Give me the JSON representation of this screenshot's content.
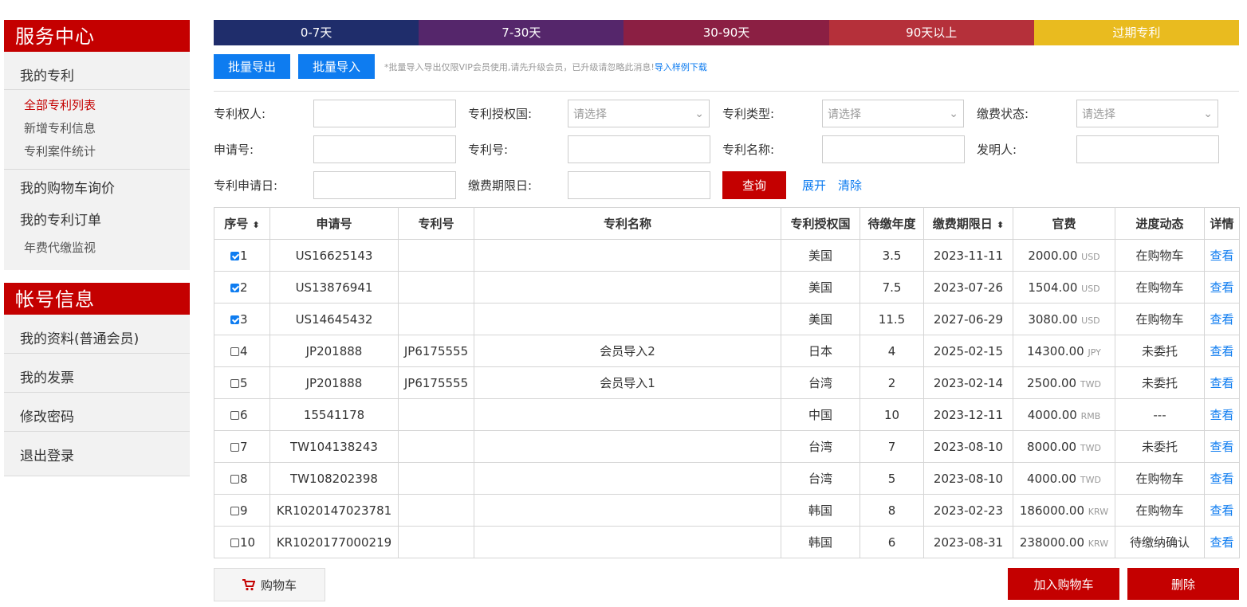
{
  "sidebar": {
    "service_title": "服务中心",
    "my_patents": "我的专利",
    "sub_items": [
      "全部专利列表",
      "新增专利信息",
      "专利案件统计"
    ],
    "cart_inquiry": "我的购物车询价",
    "my_orders": "我的专利订单",
    "annual_monitor": "年费代缴监视",
    "account_title": "帐号信息",
    "account_items": [
      "我的资料(普通会员)",
      "我的发票",
      "修改密码",
      "退出登录"
    ]
  },
  "stages": [
    {
      "label": "0-7天",
      "color": "#1f2d6b"
    },
    {
      "label": "7-30天",
      "color": "#55266b"
    },
    {
      "label": "30-90天",
      "color": "#8b1f43"
    },
    {
      "label": "90天以上",
      "color": "#b5303a"
    },
    {
      "label": "过期专利",
      "color": "#e9bb1f"
    }
  ],
  "toolbar": {
    "export_label": "批量导出",
    "import_label": "批量导入",
    "notice": "*批量导入导出仅限VIP会员使用,请先升级会员，已升级请忽略此消息!",
    "sample_link": "导入样例下载"
  },
  "filters": {
    "holder": "专利权人:",
    "country": "专利授权国:",
    "type": "专利类型:",
    "fee_status": "缴费状态:",
    "app_no": "申请号:",
    "patent_no": "专利号:",
    "patent_name": "专利名称:",
    "inventor": "发明人:",
    "app_date": "专利申请日:",
    "deadline": "缴费期限日:",
    "select_placeholder": "请选择",
    "query": "查询",
    "expand": "展开",
    "clear": "清除"
  },
  "table": {
    "headers": [
      "序号",
      "申请号",
      "专利号",
      "专利名称",
      "专利授权国",
      "待缴年度",
      "缴费期限日",
      "官费",
      "进度动态",
      "详情"
    ],
    "view_label": "查看",
    "rows": [
      {
        "no": "1",
        "checked": true,
        "app": "US16625143",
        "patent": "",
        "name": "",
        "country": "美国",
        "year": "3.5",
        "deadline": "2023-11-11",
        "fee": "2000.00",
        "cur": "USD",
        "status": "在购物车"
      },
      {
        "no": "2",
        "checked": true,
        "app": "US13876941",
        "patent": "",
        "name": "",
        "country": "美国",
        "year": "7.5",
        "deadline": "2023-07-26",
        "fee": "1504.00",
        "cur": "USD",
        "status": "在购物车"
      },
      {
        "no": "3",
        "checked": true,
        "app": "US14645432",
        "patent": "",
        "name": "",
        "country": "美国",
        "year": "11.5",
        "deadline": "2027-06-29",
        "fee": "3080.00",
        "cur": "USD",
        "status": "在购物车"
      },
      {
        "no": "4",
        "checked": false,
        "app": "JP201888",
        "patent": "JP6175555",
        "name": "会员导入2",
        "country": "日本",
        "year": "4",
        "deadline": "2025-02-15",
        "fee": "14300.00",
        "cur": "JPY",
        "status": "未委托"
      },
      {
        "no": "5",
        "checked": false,
        "app": "JP201888",
        "patent": "JP6175555",
        "name": "会员导入1",
        "country": "台湾",
        "year": "2",
        "deadline": "2023-02-14",
        "fee": "2500.00",
        "cur": "TWD",
        "status": "未委托"
      },
      {
        "no": "6",
        "checked": false,
        "app": "15541178",
        "patent": "",
        "name": "",
        "country": "中国",
        "year": "10",
        "deadline": "2023-12-11",
        "fee": "4000.00",
        "cur": "RMB",
        "status": "---"
      },
      {
        "no": "7",
        "checked": false,
        "app": "TW104138243",
        "patent": "",
        "name": "",
        "country": "台湾",
        "year": "7",
        "deadline": "2023-08-10",
        "fee": "8000.00",
        "cur": "TWD",
        "status": "未委托"
      },
      {
        "no": "8",
        "checked": false,
        "app": "TW108202398",
        "patent": "",
        "name": "",
        "country": "台湾",
        "year": "5",
        "deadline": "2023-08-10",
        "fee": "4000.00",
        "cur": "TWD",
        "status": "在购物车"
      },
      {
        "no": "9",
        "checked": false,
        "app": "KR1020147023781",
        "patent": "",
        "name": "",
        "country": "韩国",
        "year": "8",
        "deadline": "2023-02-23",
        "fee": "186000.00",
        "cur": "KRW",
        "status": "在购物车"
      },
      {
        "no": "10",
        "checked": false,
        "app": "KR1020177000219",
        "patent": "",
        "name": "",
        "country": "韩国",
        "year": "6",
        "deadline": "2023-08-31",
        "fee": "238000.00",
        "cur": "KRW",
        "status": "待缴纳确认"
      }
    ]
  },
  "bottom": {
    "cart": "购物车",
    "add_to_cart": "加入购物车",
    "delete": "删除"
  }
}
